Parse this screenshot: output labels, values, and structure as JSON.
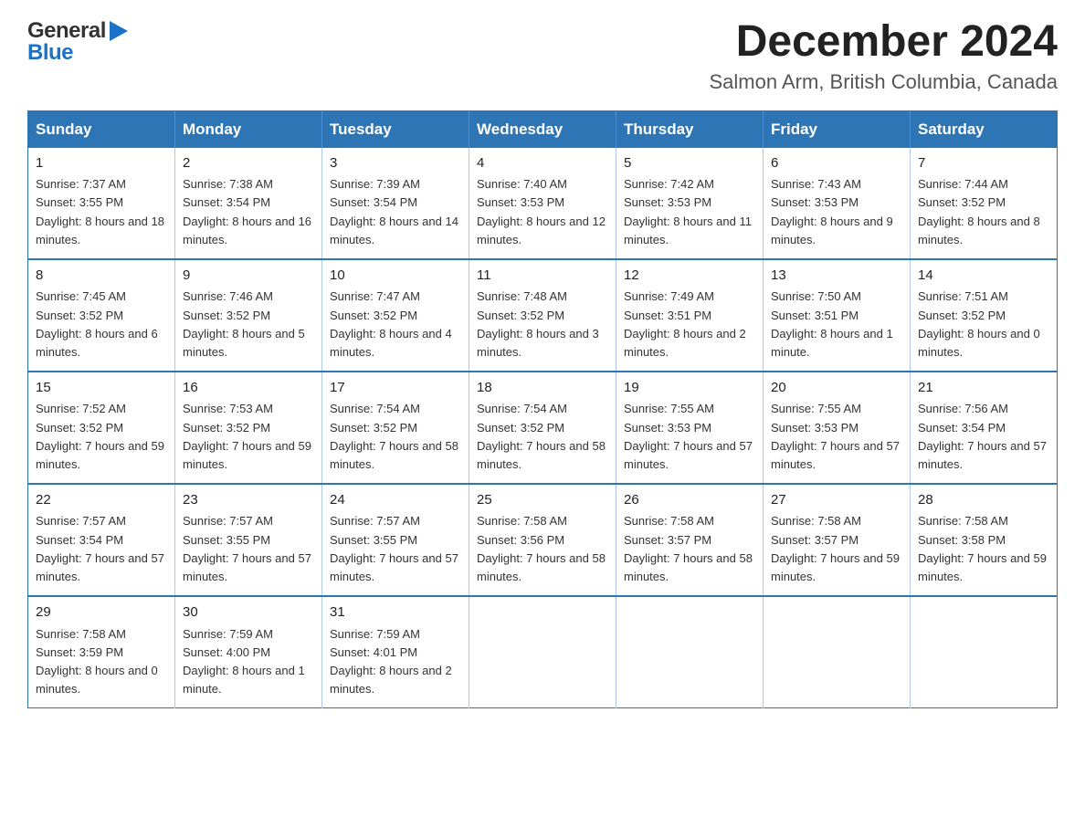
{
  "header": {
    "logo_general": "General",
    "logo_blue": "Blue",
    "month_title": "December 2024",
    "subtitle": "Salmon Arm, British Columbia, Canada"
  },
  "calendar": {
    "weekdays": [
      "Sunday",
      "Monday",
      "Tuesday",
      "Wednesday",
      "Thursday",
      "Friday",
      "Saturday"
    ],
    "weeks": [
      [
        {
          "day": "1",
          "sunrise": "7:37 AM",
          "sunset": "3:55 PM",
          "daylight": "8 hours and 18 minutes."
        },
        {
          "day": "2",
          "sunrise": "7:38 AM",
          "sunset": "3:54 PM",
          "daylight": "8 hours and 16 minutes."
        },
        {
          "day": "3",
          "sunrise": "7:39 AM",
          "sunset": "3:54 PM",
          "daylight": "8 hours and 14 minutes."
        },
        {
          "day": "4",
          "sunrise": "7:40 AM",
          "sunset": "3:53 PM",
          "daylight": "8 hours and 12 minutes."
        },
        {
          "day": "5",
          "sunrise": "7:42 AM",
          "sunset": "3:53 PM",
          "daylight": "8 hours and 11 minutes."
        },
        {
          "day": "6",
          "sunrise": "7:43 AM",
          "sunset": "3:53 PM",
          "daylight": "8 hours and 9 minutes."
        },
        {
          "day": "7",
          "sunrise": "7:44 AM",
          "sunset": "3:52 PM",
          "daylight": "8 hours and 8 minutes."
        }
      ],
      [
        {
          "day": "8",
          "sunrise": "7:45 AM",
          "sunset": "3:52 PM",
          "daylight": "8 hours and 6 minutes."
        },
        {
          "day": "9",
          "sunrise": "7:46 AM",
          "sunset": "3:52 PM",
          "daylight": "8 hours and 5 minutes."
        },
        {
          "day": "10",
          "sunrise": "7:47 AM",
          "sunset": "3:52 PM",
          "daylight": "8 hours and 4 minutes."
        },
        {
          "day": "11",
          "sunrise": "7:48 AM",
          "sunset": "3:52 PM",
          "daylight": "8 hours and 3 minutes."
        },
        {
          "day": "12",
          "sunrise": "7:49 AM",
          "sunset": "3:51 PM",
          "daylight": "8 hours and 2 minutes."
        },
        {
          "day": "13",
          "sunrise": "7:50 AM",
          "sunset": "3:51 PM",
          "daylight": "8 hours and 1 minute."
        },
        {
          "day": "14",
          "sunrise": "7:51 AM",
          "sunset": "3:52 PM",
          "daylight": "8 hours and 0 minutes."
        }
      ],
      [
        {
          "day": "15",
          "sunrise": "7:52 AM",
          "sunset": "3:52 PM",
          "daylight": "7 hours and 59 minutes."
        },
        {
          "day": "16",
          "sunrise": "7:53 AM",
          "sunset": "3:52 PM",
          "daylight": "7 hours and 59 minutes."
        },
        {
          "day": "17",
          "sunrise": "7:54 AM",
          "sunset": "3:52 PM",
          "daylight": "7 hours and 58 minutes."
        },
        {
          "day": "18",
          "sunrise": "7:54 AM",
          "sunset": "3:52 PM",
          "daylight": "7 hours and 58 minutes."
        },
        {
          "day": "19",
          "sunrise": "7:55 AM",
          "sunset": "3:53 PM",
          "daylight": "7 hours and 57 minutes."
        },
        {
          "day": "20",
          "sunrise": "7:55 AM",
          "sunset": "3:53 PM",
          "daylight": "7 hours and 57 minutes."
        },
        {
          "day": "21",
          "sunrise": "7:56 AM",
          "sunset": "3:54 PM",
          "daylight": "7 hours and 57 minutes."
        }
      ],
      [
        {
          "day": "22",
          "sunrise": "7:57 AM",
          "sunset": "3:54 PM",
          "daylight": "7 hours and 57 minutes."
        },
        {
          "day": "23",
          "sunrise": "7:57 AM",
          "sunset": "3:55 PM",
          "daylight": "7 hours and 57 minutes."
        },
        {
          "day": "24",
          "sunrise": "7:57 AM",
          "sunset": "3:55 PM",
          "daylight": "7 hours and 57 minutes."
        },
        {
          "day": "25",
          "sunrise": "7:58 AM",
          "sunset": "3:56 PM",
          "daylight": "7 hours and 58 minutes."
        },
        {
          "day": "26",
          "sunrise": "7:58 AM",
          "sunset": "3:57 PM",
          "daylight": "7 hours and 58 minutes."
        },
        {
          "day": "27",
          "sunrise": "7:58 AM",
          "sunset": "3:57 PM",
          "daylight": "7 hours and 59 minutes."
        },
        {
          "day": "28",
          "sunrise": "7:58 AM",
          "sunset": "3:58 PM",
          "daylight": "7 hours and 59 minutes."
        }
      ],
      [
        {
          "day": "29",
          "sunrise": "7:58 AM",
          "sunset": "3:59 PM",
          "daylight": "8 hours and 0 minutes."
        },
        {
          "day": "30",
          "sunrise": "7:59 AM",
          "sunset": "4:00 PM",
          "daylight": "8 hours and 1 minute."
        },
        {
          "day": "31",
          "sunrise": "7:59 AM",
          "sunset": "4:01 PM",
          "daylight": "8 hours and 2 minutes."
        },
        null,
        null,
        null,
        null
      ]
    ]
  }
}
